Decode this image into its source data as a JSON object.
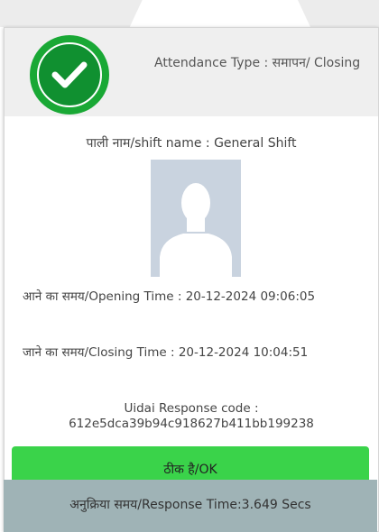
{
  "dialog": {
    "attendance_type": "Attendance Type : समापन/ Closing",
    "shift_name": "पाली नाम/shift name : General Shift",
    "opening_time": "आने का समय/Opening Time : 20-12-2024 09:06:05",
    "closing_time": "जाने का समय/Closing Time : 20-12-2024 10:04:51",
    "uidai_label": "Uidai Response code :",
    "uidai_code": "612e5dca39b94c918627b411bb199238",
    "ok_label": "ठीक है/OK",
    "response_time": "अनुक्रिया  समय/Response Time:3.649 Secs"
  },
  "colors": {
    "success_green": "#19a835",
    "button_green": "#3ad34a",
    "footer_bg": "#9fb3b6"
  },
  "icons": {
    "status": "check-circle-icon",
    "photo": "user-placeholder-icon"
  }
}
